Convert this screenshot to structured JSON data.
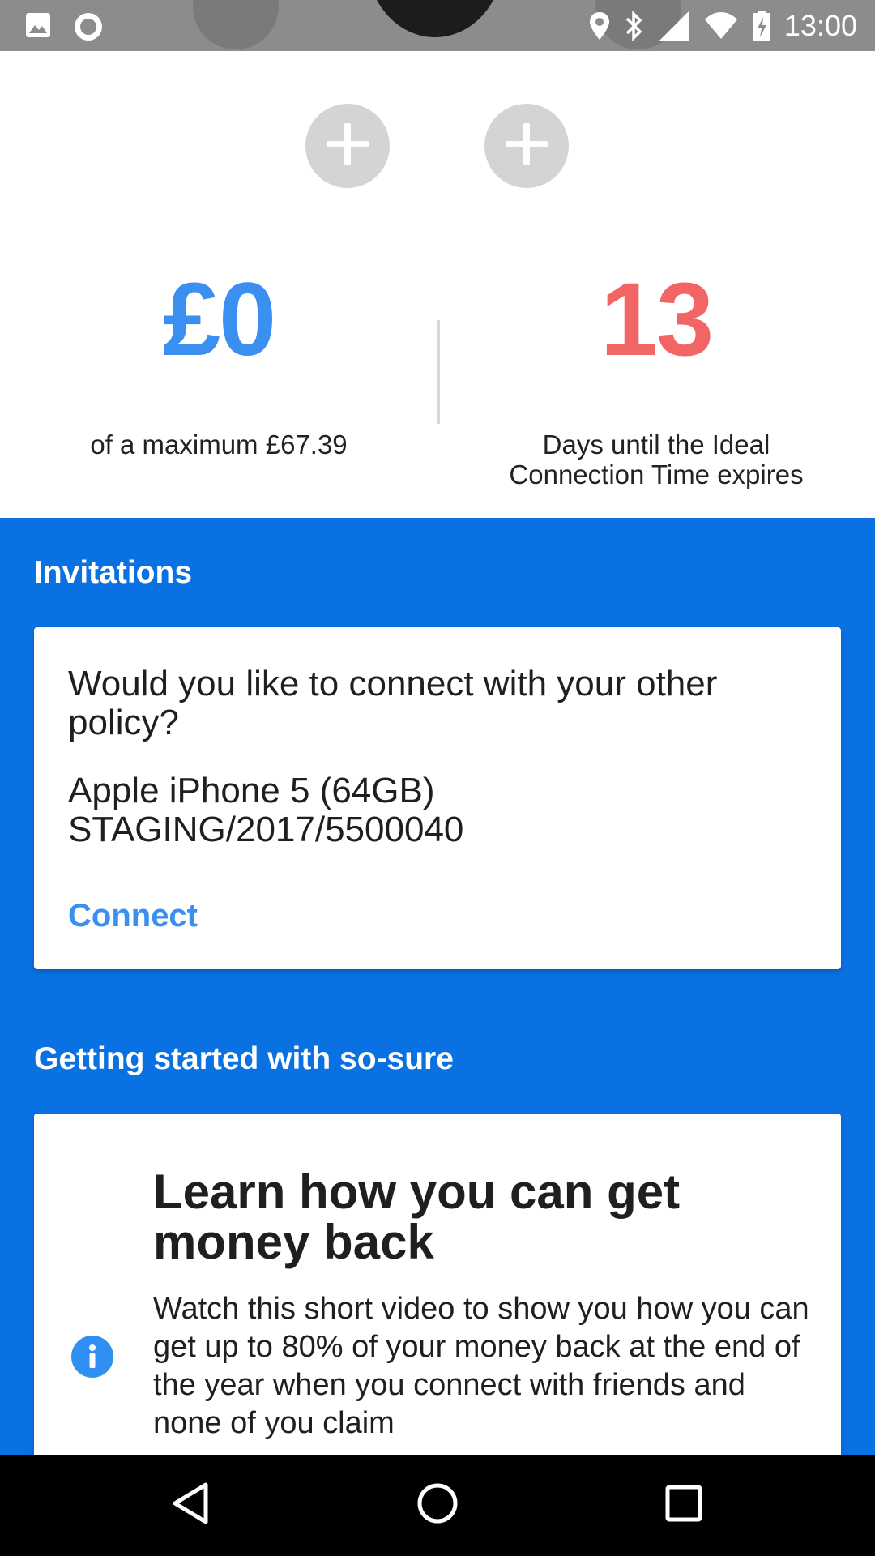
{
  "status_bar": {
    "time": "13:00",
    "left_icons": [
      "image-icon",
      "record-icon"
    ],
    "right_icons": [
      "location-icon",
      "bluetooth-icon",
      "cell-signal-icon",
      "wifi-icon",
      "battery-charging-icon"
    ]
  },
  "add_buttons": [
    {
      "icon": "plus-icon"
    },
    {
      "icon": "plus-icon"
    }
  ],
  "stats": {
    "reward_value": "£0",
    "reward_caption": "of a maximum £67.39",
    "days_value": "13",
    "days_caption": "Days until the Ideal Connection Time expires"
  },
  "invitations": {
    "title": "Invitations",
    "card": {
      "question": "Would you like to connect with your other policy?",
      "device": "Apple iPhone 5 (64GB)",
      "reference": "STAGING/2017/5500040",
      "connect_label": "Connect"
    }
  },
  "getting_started": {
    "title": "Getting started with so-sure",
    "card": {
      "title": "Learn how you can get money back",
      "body": "Watch this short video to show you how you can get up to 80% of your money back at the end of the year when you connect with friends and none of you claim",
      "icon": "info-icon"
    }
  },
  "colors": {
    "primary_blue": "#0a71e2",
    "reward_blue": "#3a8ff0",
    "days_red": "#f26565"
  },
  "nav_bar": {
    "buttons": [
      "back-icon",
      "home-icon",
      "recent-apps-icon"
    ]
  }
}
